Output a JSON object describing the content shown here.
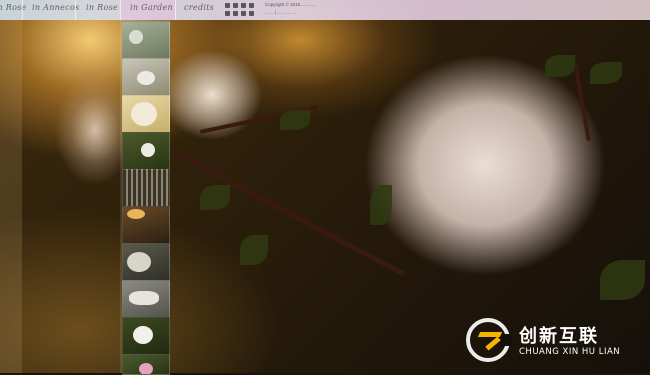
{
  "nav": {
    "items": [
      {
        "label": "In Rose"
      },
      {
        "label": "in Annecos"
      },
      {
        "label": "in Rose"
      },
      {
        "label": "in Garden"
      },
      {
        "label": "credits"
      }
    ]
  },
  "footer_info": {
    "copyright": "Copyright © 2015 ............",
    "contact": "... ... | ... ... ... ..."
  },
  "thumbnails": [
    {
      "label": "garden-arch"
    },
    {
      "label": "rose-bloom"
    },
    {
      "label": "rose-closeup"
    },
    {
      "label": "white-blossom"
    },
    {
      "label": "iron-gate"
    },
    {
      "label": "rose-bud"
    },
    {
      "label": "white-rose"
    },
    {
      "label": "feather-petals"
    },
    {
      "label": "white-rose-pair"
    }
  ],
  "watermark": {
    "cn": "创新互联",
    "en": "CHUANG XIN HU LIAN"
  }
}
